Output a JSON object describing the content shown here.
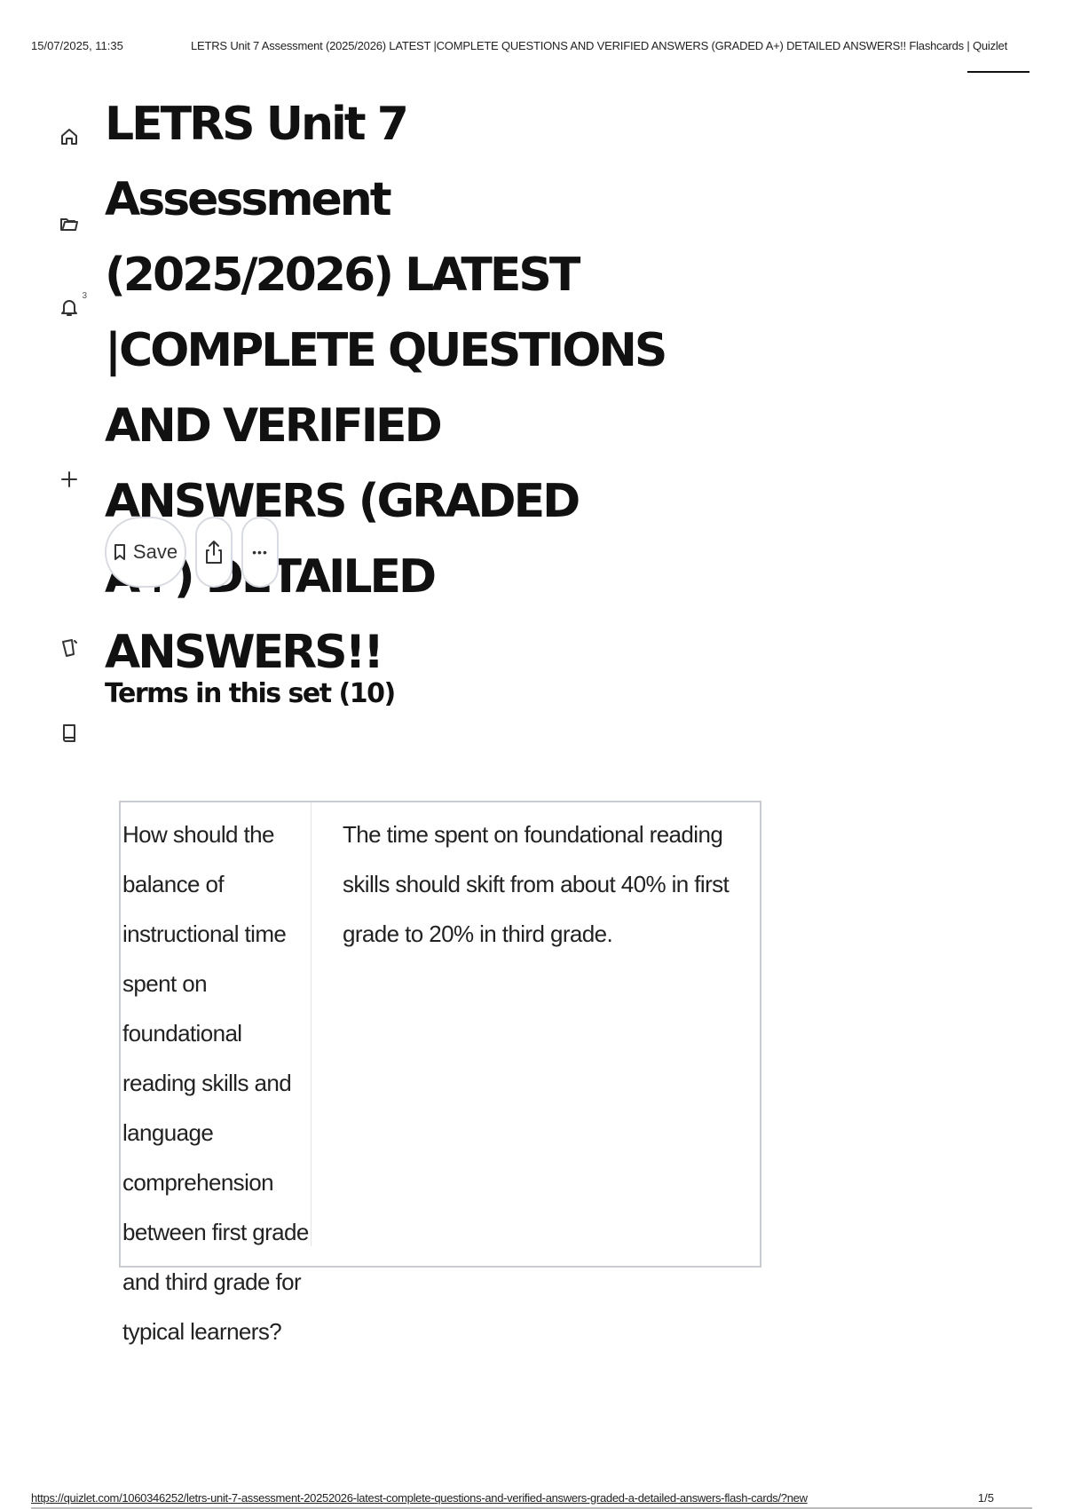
{
  "print_header": {
    "datetime": "15/07/2025, 11:35",
    "doc_title": "LETRS Unit 7 Assessment (2025/2026) LATEST |COMPLETE QUESTIONS AND VERIFIED ANSWERS (GRADED A+) DETAILED ANSWERS!! Flashcards | Quizlet"
  },
  "sidebar": {
    "icons": [
      "home-icon",
      "folder-icon",
      "bell-icon",
      "plus-icon",
      "flashcards-icon",
      "book-icon"
    ],
    "notification_badge": "3"
  },
  "set": {
    "title": "LETRS Unit 7 Assessment (2025/2026) LATEST |COMPLETE QUESTIONS AND VERIFIED ANSWERS (GRADED A+) DETAILED ANSWERS!!",
    "actions": {
      "save_label": "Save",
      "share_icon": "share-icon",
      "more_label": "•••"
    },
    "terms_heading": "Terms in this set (10)"
  },
  "terms": [
    {
      "term": "How should the balance of instructional time spent on foundational reading skills and language comprehension between first grade and third grade for typical learners?",
      "definition": "The time spent on foundational reading skills should skift from about 40% in first grade to 20% in third grade."
    }
  ],
  "print_footer": {
    "url": "https://quizlet.com/1060346252/letrs-unit-7-assessment-20252026-latest-complete-questions-and-verified-answers-graded-a-detailed-answers-flash-cards/?new",
    "page": "1/5"
  }
}
